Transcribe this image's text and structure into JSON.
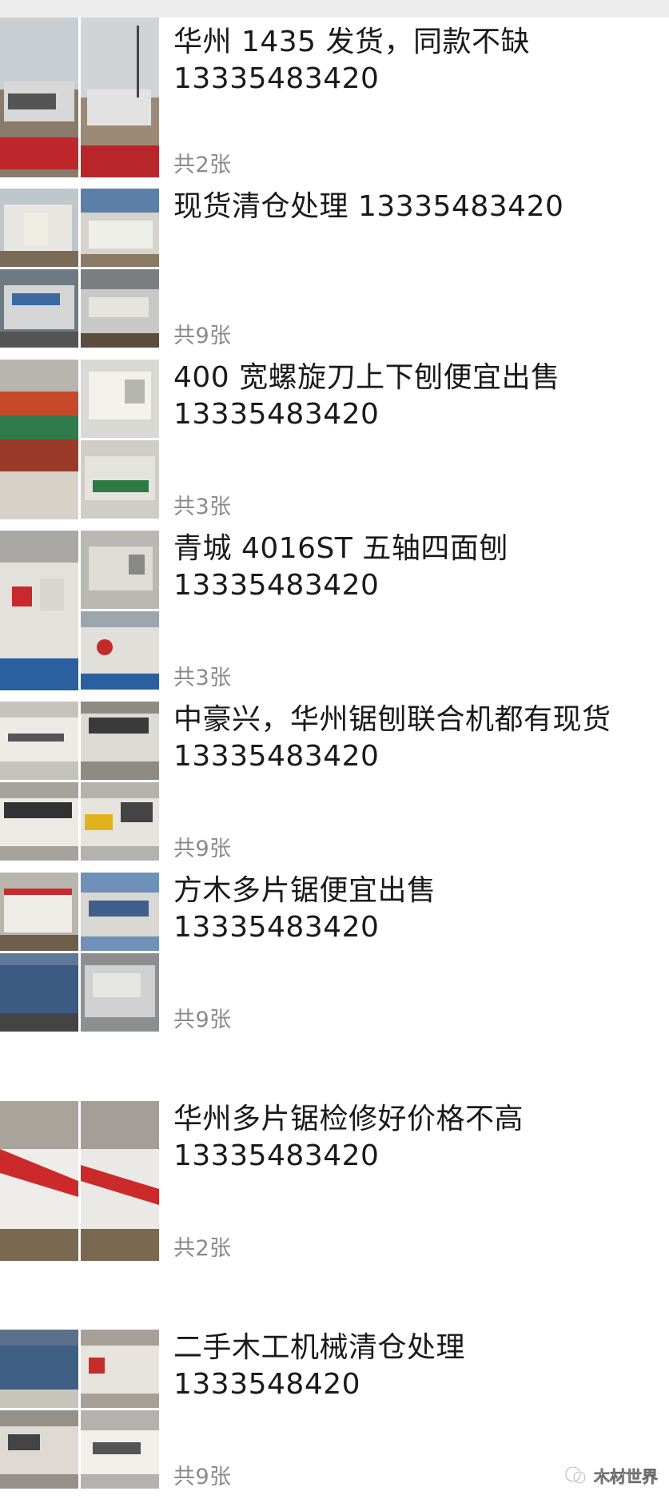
{
  "posts": [
    {
      "line1": "华州 1435 发货，同款不缺",
      "line2": "13335483420",
      "count": "共2张",
      "photos": 2
    },
    {
      "line1": "现货清仓处理 13335483420",
      "line2": "",
      "count": "共9张",
      "photos": 4
    },
    {
      "line1": "400 宽螺旋刀上下刨便宜出售",
      "line2": "13335483420",
      "count": "共3张",
      "photos": 3
    },
    {
      "line1": "青城 4016ST 五轴四面刨",
      "line2": "13335483420",
      "count": "共3张",
      "photos": 3
    },
    {
      "line1": "中豪兴，华州锯刨联合机都有现货",
      "line2": "13335483420",
      "count": "共9张",
      "photos": 4
    },
    {
      "line1": "方木多片锯便宜出售",
      "line2": "13335483420",
      "count": "共9张",
      "photos": 4
    },
    {
      "line1": "华州多片锯检修好价格不高",
      "line2": "13335483420",
      "count": "共2张",
      "photos": 2
    },
    {
      "line1": "二手木工机械清仓处理",
      "line2": "1333548420",
      "count": "共9张",
      "photos": 4
    }
  ],
  "watermark": {
    "icon": "wechat-channel-icon",
    "text": "木材世界"
  }
}
